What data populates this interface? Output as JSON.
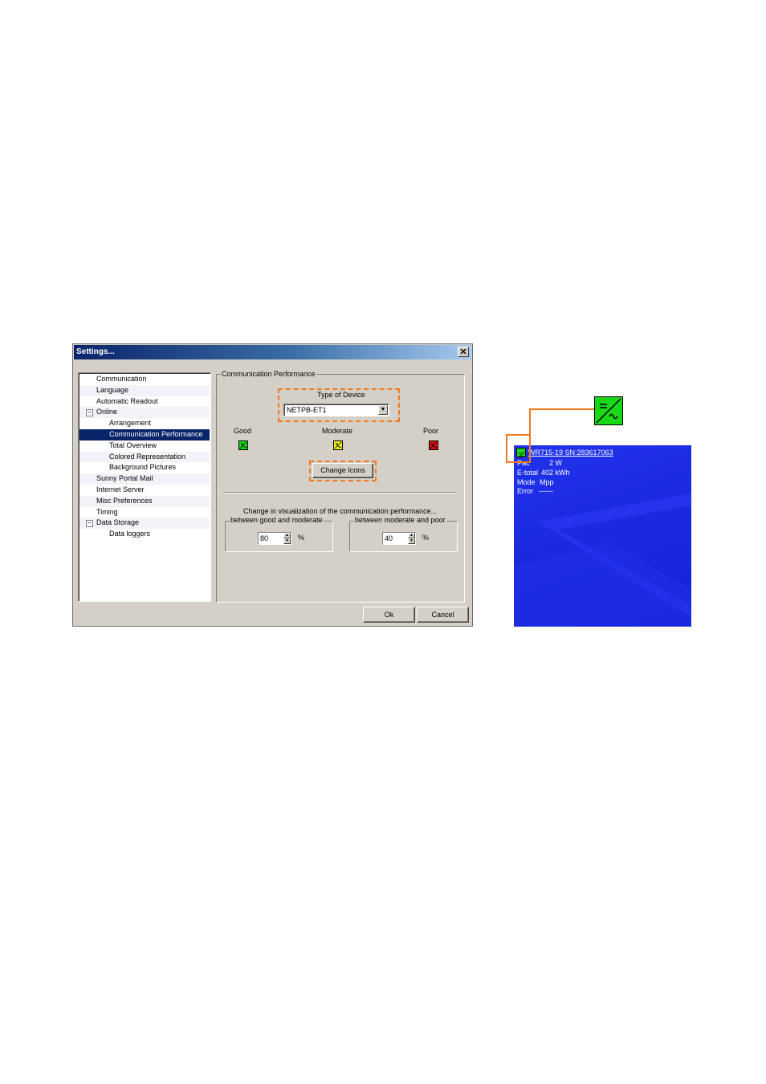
{
  "dialog": {
    "title": "Settings...",
    "close_glyph": "✕",
    "tree": [
      {
        "label": "Communication",
        "level": 0
      },
      {
        "label": "Language",
        "level": 0
      },
      {
        "label": "Automatic Readout",
        "level": 0
      },
      {
        "label": "Online",
        "level": 0,
        "expander": "−"
      },
      {
        "label": "Arrangement",
        "level": 1
      },
      {
        "label": "Communication Performance",
        "level": 1,
        "selected": true
      },
      {
        "label": "Total Overview",
        "level": 1
      },
      {
        "label": "Colored Representation",
        "level": 1
      },
      {
        "label": "Background Pictures",
        "level": 1
      },
      {
        "label": "Sunny Portal Mail",
        "level": 0
      },
      {
        "label": "Internet Server",
        "level": 0
      },
      {
        "label": "Misc Preferences",
        "level": 0
      },
      {
        "label": "Timing",
        "level": 0
      },
      {
        "label": "Data Storage",
        "level": 0,
        "expander": "−"
      },
      {
        "label": "Data loggers",
        "level": 1
      }
    ],
    "panel": {
      "legend": "Communication Performance",
      "type_of_device_label": "Type of Device",
      "device_value": "NETPB-ET1",
      "status": {
        "good_label": "Good",
        "moderate_label": "Moderate",
        "poor_label": "Poor",
        "good_color": "#18d818",
        "moderate_color": "#f0f020",
        "poor_color": "#e01010"
      },
      "change_icons_label": "Change Icons",
      "change_text": "Change in visualization of the communication performance...",
      "group_good_moderate": {
        "legend": "between good and moderate",
        "value": "80",
        "unit": "%"
      },
      "group_moderate_poor": {
        "legend": "between moderate and poor",
        "value": "40",
        "unit": "%"
      }
    },
    "ok_label": "Ok",
    "cancel_label": "Cancel"
  },
  "device_view": {
    "name": "WR715-19 SN:283617063",
    "rows": [
      {
        "label": "Pac",
        "value": "2 W"
      },
      {
        "label": "E-total",
        "value": "402 kWh"
      },
      {
        "label": "Mode",
        "value": "Mpp"
      },
      {
        "label": "Error",
        "value": "------"
      }
    ],
    "background_color": "#1a2be0"
  },
  "highlight_color": "#ee7a1f"
}
